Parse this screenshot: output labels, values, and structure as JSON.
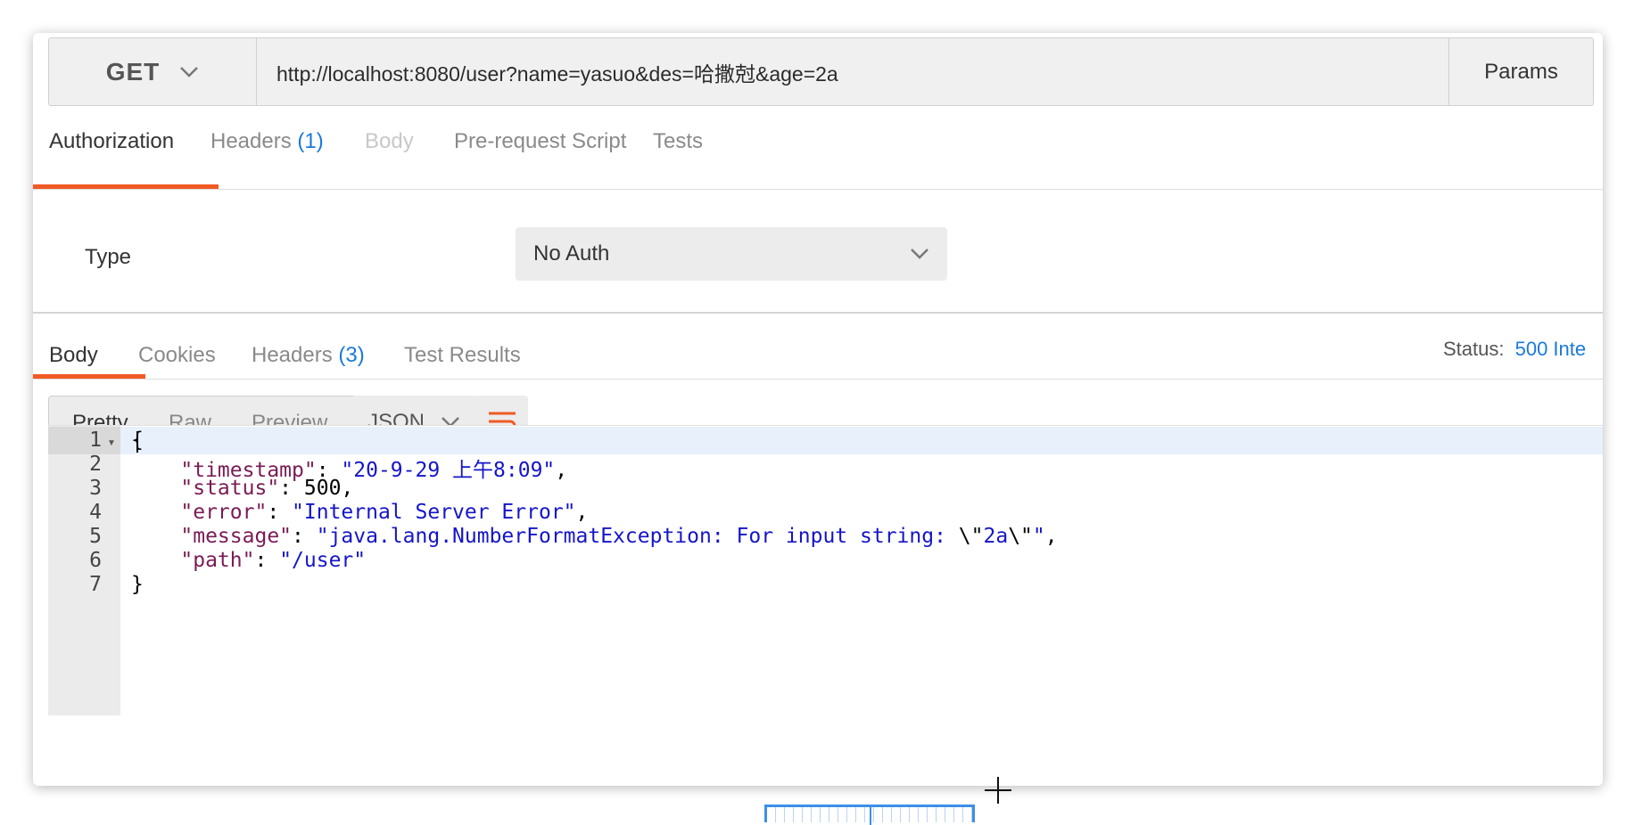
{
  "request": {
    "method": "GET",
    "url": "http://localhost:8080/user?name=yasuo&des=哈撒尅&age=2a",
    "params_label": "Params"
  },
  "request_tabs": {
    "authorization": "Authorization",
    "headers": "Headers",
    "headers_count": "(1)",
    "body": "Body",
    "pre_request": "Pre-request Script",
    "tests": "Tests"
  },
  "auth": {
    "type_label": "Type",
    "type_value": "No Auth"
  },
  "response_tabs": {
    "body": "Body",
    "cookies": "Cookies",
    "headers": "Headers",
    "headers_count": "(3)",
    "test_results": "Test Results"
  },
  "status": {
    "label": "Status:",
    "value": "500 Inte"
  },
  "view": {
    "pretty": "Pretty",
    "raw": "Raw",
    "preview": "Preview",
    "format": "JSON"
  },
  "code": {
    "line_numbers": [
      "1",
      "2",
      "3",
      "4",
      "5",
      "6",
      "7"
    ],
    "l1": "{",
    "l2_key": "\"timestamp\"",
    "l2_val": "\"20-9-29 上午8:09\"",
    "l3_key": "\"status\"",
    "l3_val": "500",
    "l4_key": "\"error\"",
    "l4_val": "\"Internal Server Error\"",
    "l5_key": "\"message\"",
    "l5_val_a": "\"java.lang.NumberFormatException: For input string: ",
    "l5_esc1": "\\\"",
    "l5_val_b": "2a",
    "l5_esc2": "\\\"",
    "l5_val_c": "\"",
    "l6_key": "\"path\"",
    "l6_val": "\"/user\"",
    "l7": "}"
  },
  "colors": {
    "accent": "#f15a24",
    "link": "#1a7ad8",
    "json_key": "#7a1c54",
    "json_string": "#1515c9"
  }
}
